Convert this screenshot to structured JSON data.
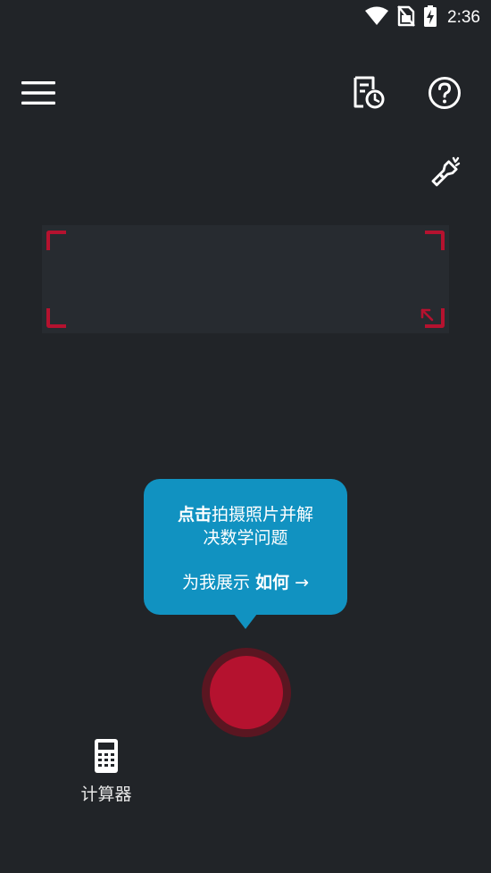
{
  "status_bar": {
    "time": "2:36",
    "icons": [
      "wifi-icon",
      "no-sim-icon",
      "battery-charging-icon"
    ]
  },
  "toolbar": {
    "menu_icon": "hamburger-menu-icon",
    "history_icon": "history-document-icon",
    "help_icon": "help-circle-icon",
    "flashlight_icon": "flashlight-icon"
  },
  "scan_frame": {
    "resize_icon": "resize-arrow-icon"
  },
  "tooltip": {
    "tap_label": "点击",
    "instruction_rest": "拍摄照片并解",
    "instruction_line2": "决数学问题",
    "show_me": "为我展示",
    "how": "如何",
    "arrow": "→"
  },
  "bottom": {
    "calculator_label": "计算器",
    "calculator_icon": "calculator-icon"
  },
  "colors": {
    "background": "#212428",
    "accent": "#b5122f",
    "tooltip": "#1192c1"
  }
}
